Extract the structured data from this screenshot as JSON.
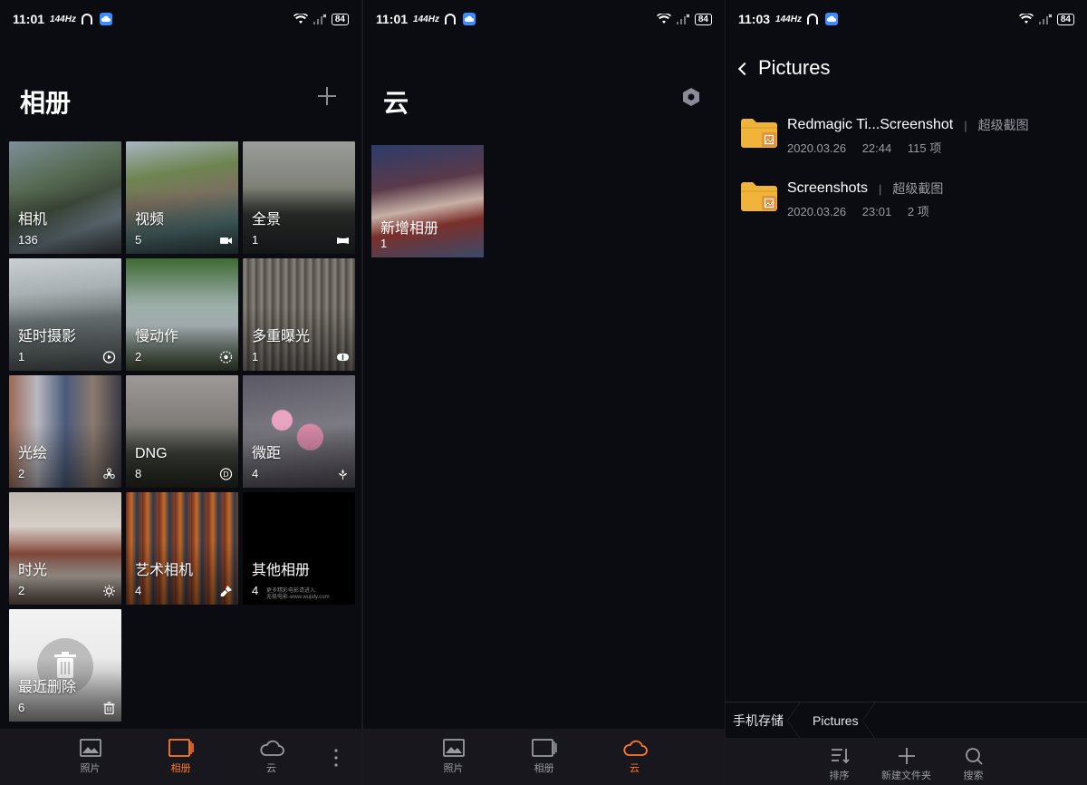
{
  "colors": {
    "accent": "#ff7a2e",
    "background": "#0b0b12",
    "nav_bg": "#17171d",
    "muted": "#9a9aa2",
    "folder": "#f0b43a"
  },
  "screen1": {
    "status": {
      "time": "11:01",
      "hz": "144Hz",
      "battery": "84"
    },
    "title": "相册",
    "albums": [
      {
        "name": "相机",
        "count": "136",
        "icon": null
      },
      {
        "name": "视频",
        "count": "5",
        "icon": "video-icon"
      },
      {
        "name": "全景",
        "count": "1",
        "icon": "panorama-icon"
      },
      {
        "name": "延时摄影",
        "count": "1",
        "icon": "timelapse-icon"
      },
      {
        "name": "慢动作",
        "count": "2",
        "icon": "slow-motion-icon"
      },
      {
        "name": "多重曝光",
        "count": "1",
        "icon": "multi-exposure-icon"
      },
      {
        "name": "光绘",
        "count": "2",
        "icon": "light-painting-icon"
      },
      {
        "name": "DNG",
        "count": "8",
        "icon": "dng-icon"
      },
      {
        "name": "微距",
        "count": "4",
        "icon": "macro-flower-icon"
      },
      {
        "name": "时光",
        "count": "2",
        "icon": "sun-icon"
      },
      {
        "name": "艺术相机",
        "count": "4",
        "icon": "brush-icon"
      },
      {
        "name": "其他相册",
        "count": "4",
        "icon": null,
        "note_line1": "更多精彩电影请进入:",
        "note_line2": "无极电影-www.wujidy.com"
      },
      {
        "name": "最近删除",
        "count": "6",
        "icon": "trash-icon"
      }
    ],
    "nav": [
      {
        "label": "照片",
        "icon": "photo-icon",
        "active": false
      },
      {
        "label": "相册",
        "icon": "album-icon",
        "active": true
      },
      {
        "label": "云",
        "icon": "cloud-icon",
        "active": false
      }
    ]
  },
  "screen2": {
    "status": {
      "time": "11:01",
      "hz": "144Hz",
      "battery": "84"
    },
    "title": "云",
    "album": {
      "name": "新增相册",
      "count": "1"
    },
    "nav": [
      {
        "label": "照片",
        "icon": "photo-icon",
        "active": false
      },
      {
        "label": "相册",
        "icon": "album-icon",
        "active": false
      },
      {
        "label": "云",
        "icon": "cloud-icon",
        "active": true
      }
    ]
  },
  "screen3": {
    "status": {
      "time": "11:03",
      "hz": "144Hz",
      "battery": "84"
    },
    "title": "Pictures",
    "folders": [
      {
        "name": "Redmagic Ti...Screenshot",
        "tag": "超级截图",
        "date": "2020.03.26",
        "time": "22:44",
        "count": "115 项"
      },
      {
        "name": "Screenshots",
        "tag": "超级截图",
        "date": "2020.03.26",
        "time": "23:01",
        "count": "2 项"
      }
    ],
    "breadcrumb": [
      "手机存储",
      "Pictures"
    ],
    "toolbar": [
      {
        "label": "排序",
        "icon": "sort-icon"
      },
      {
        "label": "新建文件夹",
        "icon": "plus-icon"
      },
      {
        "label": "搜索",
        "icon": "search-icon"
      }
    ]
  }
}
